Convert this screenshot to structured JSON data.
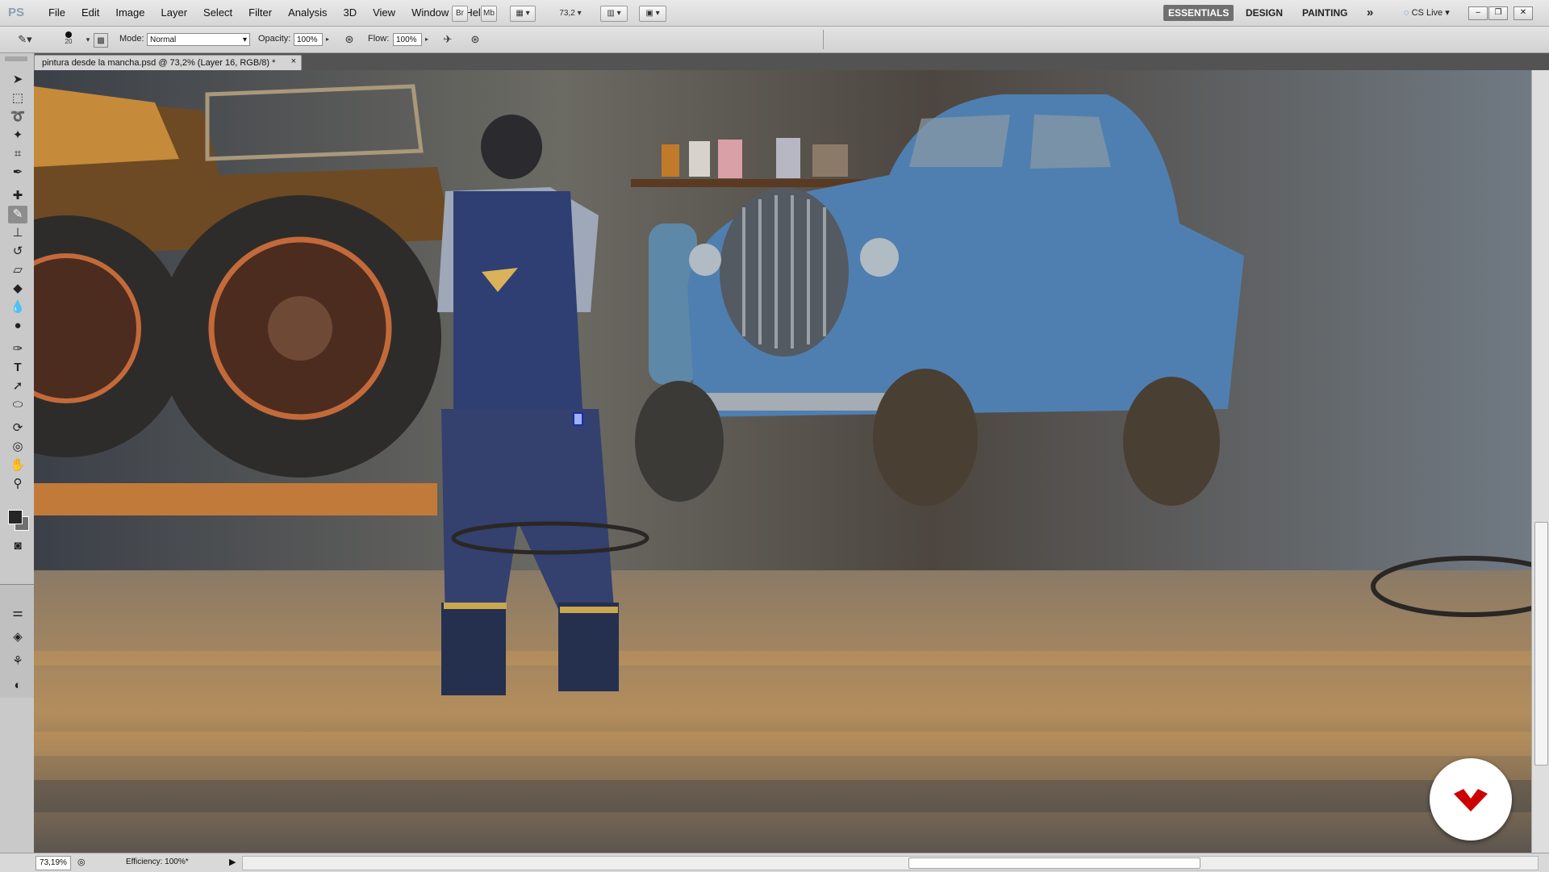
{
  "menubar": {
    "logo": "PS",
    "items": [
      "File",
      "Edit",
      "Image",
      "Layer",
      "Select",
      "Filter",
      "Analysis",
      "3D",
      "View",
      "Window",
      "Help"
    ],
    "bridge": "Br",
    "minibridge": "Mb",
    "zoom_value": "73,2",
    "workspaces": [
      "ESSENTIALS",
      "DESIGN",
      "PAINTING"
    ],
    "more": "»",
    "cslive": "CS Live"
  },
  "options": {
    "brush_size": "20",
    "mode_label": "Mode:",
    "mode_value": "Normal",
    "opacity_label": "Opacity:",
    "opacity_value": "100%",
    "flow_label": "Flow:",
    "flow_value": "100%"
  },
  "document": {
    "tab_title": "pintura desde la mancha.psd @ 73,2% (Layer 16, RGB/8) *",
    "close": "×"
  },
  "status": {
    "zoom": "73,19%",
    "efficiency": "Efficiency: 100%*"
  },
  "colors": {
    "accent": "#cc0000",
    "foreground_swatch": "#262626",
    "background_swatch": "#707070"
  }
}
